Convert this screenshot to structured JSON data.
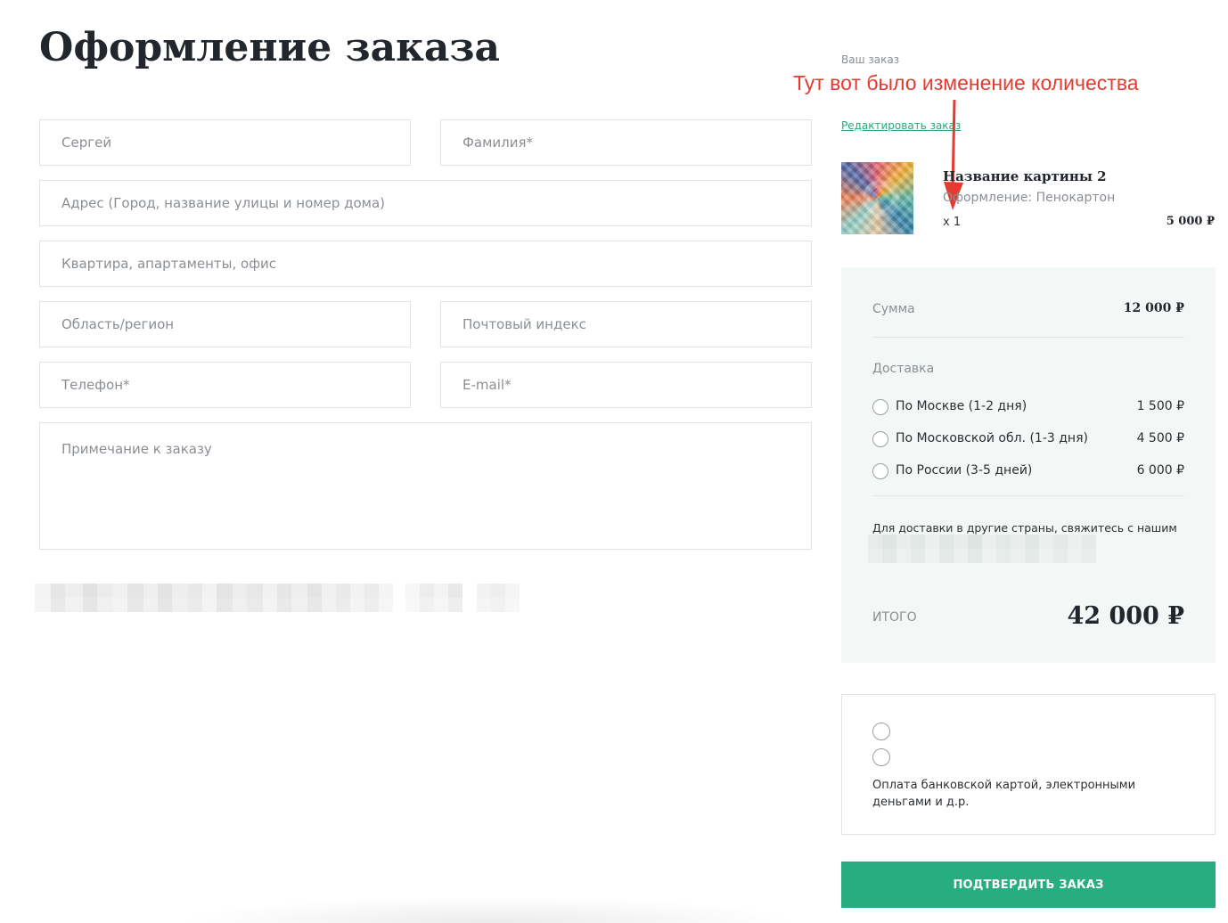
{
  "page": {
    "title": "Оформление заказа"
  },
  "form": {
    "first_name": {
      "value": "",
      "placeholder": "Сергей"
    },
    "last_name": {
      "value": "",
      "placeholder": "Фамилия*"
    },
    "address": {
      "value": "",
      "placeholder": "Адрес (Город, название улицы и номер дома)"
    },
    "apartment": {
      "value": "",
      "placeholder": "Квартира, апартаменты, офис"
    },
    "region": {
      "value": "",
      "placeholder": "Область/регион"
    },
    "postcode": {
      "value": "",
      "placeholder": "Почтовый индекс"
    },
    "phone": {
      "value": "",
      "placeholder": "Телефон*"
    },
    "email": {
      "value": "",
      "placeholder": "E-mail*"
    },
    "note": {
      "value": "",
      "placeholder": "Примечание к заказу"
    }
  },
  "order": {
    "label": "Ваш заказ",
    "edit_link": "Редактировать заказ",
    "annotation": "Тут вот было изменение количества",
    "item": {
      "name": "Название картины 2",
      "frame": "Оформление: Пенокартон",
      "qty": "х 1",
      "price": "5 000 ₽"
    }
  },
  "summary": {
    "sum_label": "Сумма",
    "sum_value": "12 000 ₽",
    "delivery_label": "Доставка",
    "delivery_options": [
      {
        "name": "По Москве (1-2 дня)",
        "price": "1 500 ₽"
      },
      {
        "name": "По Московской обл. (1-3 дня)",
        "price": "4 500 ₽"
      },
      {
        "name": "По России (3-5 дней)",
        "price": "6 000 ₽"
      }
    ],
    "note": "Для доставки в другие страны, свяжитесь с нашим",
    "total_label": "ИТОГО",
    "total_value": "42 000 ₽"
  },
  "payment": {
    "options_count": 2,
    "text": "Оплата банковской картой, электронными деньгами и д.р."
  },
  "confirm_button": "ПОДТВЕРДИТЬ ЗАКАЗ",
  "colors": {
    "accent": "#28ad80",
    "link": "#28a87b",
    "annotation": "#e43a30",
    "summary_bg": "#f3f8f6"
  }
}
